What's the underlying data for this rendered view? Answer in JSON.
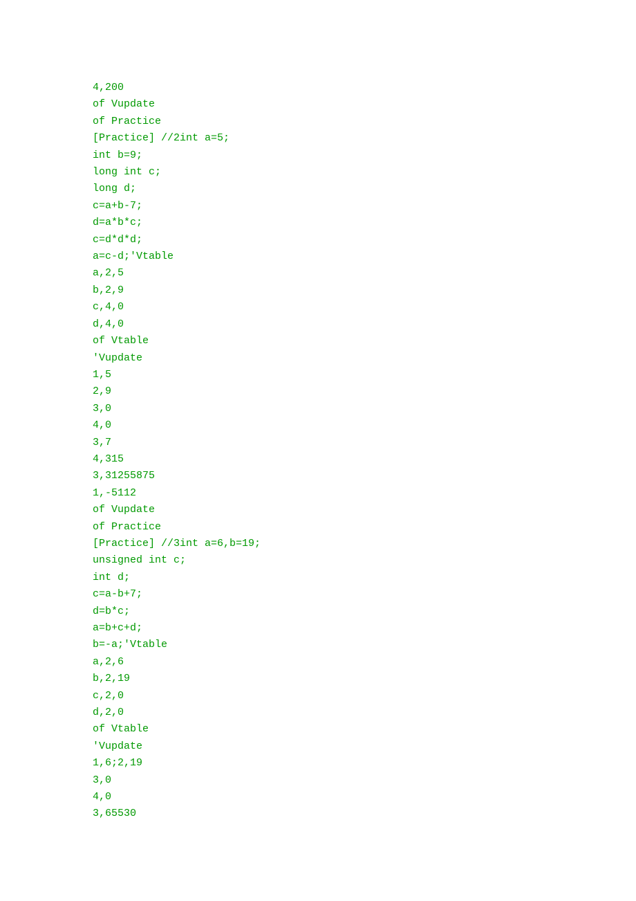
{
  "lines": [
    "4,200",
    "of Vupdate",
    "of Practice",
    "[Practice] //2int a=5;",
    "int b=9;",
    "long int c;",
    "long d;",
    "c=a+b-7;",
    "d=a*b*c;",
    "c=d*d*d;",
    "a=c-d;'Vtable",
    "a,2,5",
    "b,2,9",
    "c,4,0",
    "d,4,0",
    "of Vtable",
    "'Vupdate",
    "1,5",
    "2,9",
    "3,0",
    "4,0",
    "3,7",
    "4,315",
    "3,31255875",
    "1,-5112",
    "of Vupdate",
    "of Practice",
    "[Practice] //3int a=6,b=19;",
    "unsigned int c;",
    "int d;",
    "c=a-b+7;",
    "d=b*c;",
    "a=b+c+d;",
    "b=-a;'Vtable",
    "a,2,6",
    "b,2,19",
    "c,2,0",
    "d,2,0",
    "of Vtable",
    "'Vupdate",
    "1,6;2,19",
    "3,0",
    "4,0",
    "3,65530"
  ]
}
